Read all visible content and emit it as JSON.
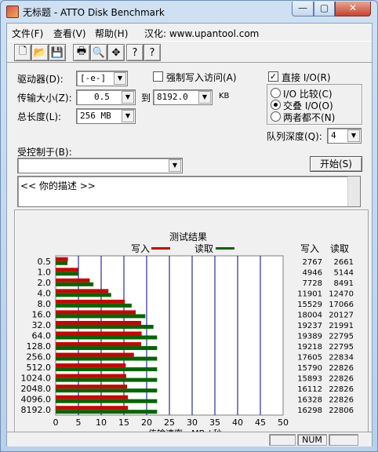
{
  "window": {
    "title": "无标题 - ATTO Disk Benchmark"
  },
  "caption": {
    "min": "—",
    "max": "▢",
    "close": "✕"
  },
  "menu": [
    "文件(F)",
    "查看(V)",
    "帮助(H)",
    "汉化: www.upantool.com"
  ],
  "toolbar": {
    "icons": [
      "new-file-icon",
      "open-folder-icon",
      "save-icon",
      "print-icon",
      "print-preview-icon",
      "move-icon",
      "help-icon",
      "context-help-icon"
    ],
    "glyphs": [
      "🗋",
      "📂",
      "💾",
      "🖶",
      "🔍",
      "✥",
      "?",
      "?"
    ]
  },
  "form": {
    "drive_label": "驱动器(D):",
    "drive_value": "[-e-]",
    "force_write_label": "强制写入访问(A)",
    "force_write_checked": false,
    "transfer_label": "传输大小(Z):",
    "transfer_min": "0.5",
    "to_label": "到",
    "transfer_max": "8192.0",
    "kb_label": "KB",
    "total_label": "总长度(L):",
    "total_value": "256 MB",
    "direct_io_label": "直接 I/O(R)",
    "direct_io_checked": true,
    "radio_options": [
      {
        "label": "I/O 比较(C)",
        "selected": false
      },
      {
        "label": "交叠 I/O(O)",
        "selected": true
      },
      {
        "label": "两者都不(N)",
        "selected": false
      }
    ],
    "queue_label": "队列深度(Q):",
    "queue_value": "4",
    "controlled_label": "受控制于(B):",
    "controlled_value": "",
    "start_button": "开始(S)",
    "description": "<<   你的描述   >>"
  },
  "check_glyph": "✓",
  "arrow_glyph": "▼",
  "colors": {
    "write": "#cc0000",
    "read": "#006600",
    "grid": "#000080"
  },
  "chart_data": {
    "type": "bar",
    "title": "测试结果",
    "legend": {
      "write": "写入",
      "read": "读取",
      "placement": "top"
    },
    "columns": {
      "write": "写入",
      "read": "读取"
    },
    "xlabel": "传输速率 - MB / 秒",
    "xlim": [
      0,
      50
    ],
    "xticks": [
      "0",
      "5",
      "10",
      "15",
      "20",
      "25",
      "30",
      "35",
      "40",
      "45",
      "50"
    ],
    "categories": [
      "0.5",
      "1.0",
      "2.0",
      "4.0",
      "8.0",
      "16.0",
      "32.0",
      "64.0",
      "128.0",
      "256.0",
      "512.0",
      "1024.0",
      "2048.0",
      "4096.0",
      "8192.0"
    ],
    "series": [
      {
        "name": "写入",
        "values": [
          2.7,
          4.9,
          7.5,
          11.6,
          15.2,
          17.6,
          18.8,
          18.9,
          18.8,
          17.2,
          15.4,
          15.5,
          15.7,
          15.9,
          15.9
        ]
      },
      {
        "name": "读取",
        "values": [
          2.6,
          5.0,
          8.3,
          12.2,
          16.7,
          19.7,
          21.5,
          22.3,
          22.3,
          22.3,
          22.3,
          22.3,
          22.3,
          22.3,
          22.3
        ]
      }
    ],
    "write_values": [
      "2767",
      "4946",
      "7728",
      "11901",
      "15529",
      "18004",
      "19237",
      "19389",
      "19218",
      "17605",
      "15790",
      "15893",
      "16112",
      "16328",
      "16298"
    ],
    "read_values": [
      "2661",
      "5144",
      "8491",
      "12470",
      "17066",
      "20127",
      "21991",
      "22795",
      "22795",
      "22834",
      "22826",
      "22826",
      "22826",
      "22826",
      "22806"
    ]
  },
  "statusbar": {
    "num": "NUM"
  }
}
